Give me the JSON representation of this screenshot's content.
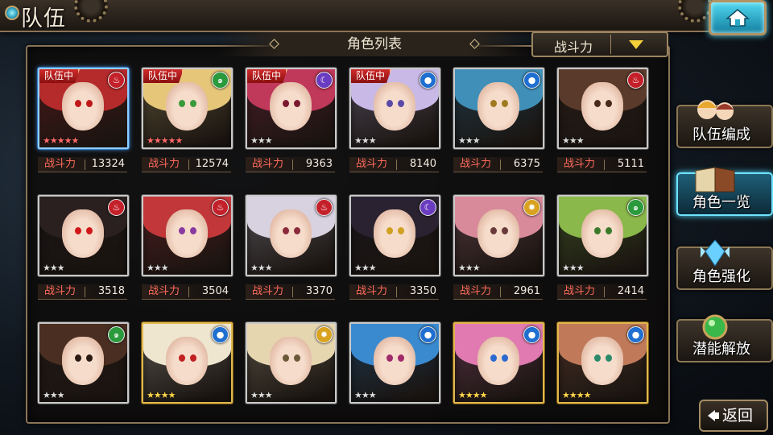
{
  "header": {
    "title": "队伍",
    "home_icon": "home-icon"
  },
  "panel": {
    "title": "角色列表",
    "sort_label": "战斗力"
  },
  "power_label": "战斗力",
  "colors": {
    "fire": "#c4202a",
    "wind": "#2a9a3c",
    "water": "#1f6fd0",
    "dark": "#6a3cc0",
    "light": "#d9a21f"
  },
  "characters": [
    {
      "in_team_label": "队伍中",
      "element": "fire",
      "element_icon": "flame-icon",
      "stars": "★★★★★",
      "star_tier": "red",
      "frame": "blue",
      "power": "13324",
      "hair": "#b52a2a",
      "eye": "#c01818"
    },
    {
      "in_team_label": "队伍中",
      "element": "wind",
      "element_icon": "swirl-icon",
      "stars": "★★★★★",
      "star_tier": "red",
      "frame": "silver",
      "power": "12574",
      "hair": "#e6c77a",
      "eye": "#3a9a3a"
    },
    {
      "in_team_label": "队伍中",
      "element": "dark",
      "element_icon": "crescent-icon",
      "stars": "★★★",
      "star_tier": "silver",
      "frame": "silver",
      "power": "9363",
      "hair": "#c0385a",
      "eye": "#7a1a30"
    },
    {
      "in_team_label": "队伍中",
      "element": "water",
      "element_icon": "droplet-icon",
      "stars": "★★★",
      "star_tier": "silver",
      "frame": "silver",
      "power": "8140",
      "hair": "#c9b9e6",
      "eye": "#5a4aa8"
    },
    {
      "in_team_label": "",
      "element": "water",
      "element_icon": "droplet-icon",
      "stars": "★★★",
      "star_tier": "silver",
      "frame": "silver",
      "power": "6375",
      "hair": "#3f8fb8",
      "eye": "#a07a20"
    },
    {
      "in_team_label": "",
      "element": "fire",
      "element_icon": "flame-icon",
      "stars": "★★★",
      "star_tier": "silver",
      "frame": "silver",
      "power": "5111",
      "hair": "#5a3a2a",
      "eye": "#4a2a1a"
    },
    {
      "in_team_label": "",
      "element": "fire",
      "element_icon": "flame-icon",
      "stars": "★★★",
      "star_tier": "silver",
      "frame": "silver",
      "power": "3518",
      "hair": "#2a2020",
      "eye": "#d01818"
    },
    {
      "in_team_label": "",
      "element": "fire",
      "element_icon": "flame-icon",
      "stars": "★★★",
      "star_tier": "silver",
      "frame": "silver",
      "power": "3504",
      "hair": "#c2383a",
      "eye": "#8a3aa0"
    },
    {
      "in_team_label": "",
      "element": "fire",
      "element_icon": "flame-icon",
      "stars": "★★★",
      "star_tier": "silver",
      "frame": "silver",
      "power": "3370",
      "hair": "#d8d2e0",
      "eye": "#8a2a3a"
    },
    {
      "in_team_label": "",
      "element": "dark",
      "element_icon": "crescent-icon",
      "stars": "★★★",
      "star_tier": "silver",
      "frame": "silver",
      "power": "3350",
      "hair": "#2a2230",
      "eye": "#d0a020"
    },
    {
      "in_team_label": "",
      "element": "light",
      "element_icon": "sun-icon",
      "stars": "★★★",
      "star_tier": "silver",
      "frame": "silver",
      "power": "2961",
      "hair": "#d88a9a",
      "eye": "#6a3a3a"
    },
    {
      "in_team_label": "",
      "element": "wind",
      "element_icon": "swirl-icon",
      "stars": "★★★",
      "star_tier": "silver",
      "frame": "silver",
      "power": "2414",
      "hair": "#8ab84a",
      "eye": "#3a7a2a"
    },
    {
      "in_team_label": "",
      "element": "wind",
      "element_icon": "swirl-icon",
      "stars": "★★★",
      "star_tier": "silver",
      "frame": "silver",
      "power": "",
      "hair": "#4a2e22",
      "eye": "#2a1a12"
    },
    {
      "in_team_label": "",
      "element": "water",
      "element_icon": "droplet-icon",
      "stars": "★★★★",
      "star_tier": "gold",
      "frame": "gold",
      "power": "",
      "hair": "#efe6d0",
      "eye": "#c02020"
    },
    {
      "in_team_label": "",
      "element": "light",
      "element_icon": "sun-icon",
      "stars": "★★★",
      "star_tier": "silver",
      "frame": "silver",
      "power": "",
      "hair": "#e6d6b0",
      "eye": "#6a5a3a"
    },
    {
      "in_team_label": "",
      "element": "water",
      "element_icon": "droplet-icon",
      "stars": "★★★",
      "star_tier": "silver",
      "frame": "silver",
      "power": "",
      "hair": "#3a8ad0",
      "eye": "#a02a6a"
    },
    {
      "in_team_label": "",
      "element": "water",
      "element_icon": "droplet-icon",
      "stars": "★★★★",
      "star_tier": "gold",
      "frame": "gold",
      "power": "",
      "hair": "#e07ab0",
      "eye": "#2a6ad0"
    },
    {
      "in_team_label": "",
      "element": "water",
      "element_icon": "droplet-icon",
      "stars": "★★★★",
      "star_tier": "gold",
      "frame": "gold",
      "power": "",
      "hair": "#c07a5a",
      "eye": "#2a8a6a"
    }
  ],
  "side_menu": [
    {
      "label": "队伍编成",
      "icon": "team-portraits-icon",
      "active": false
    },
    {
      "label": "角色一览",
      "icon": "book-icon",
      "active": true
    },
    {
      "label": "角色强化",
      "icon": "crystal-icon",
      "active": false
    },
    {
      "label": "潜能解放",
      "icon": "green-orb-icon",
      "active": false
    }
  ],
  "back_label": "返回"
}
